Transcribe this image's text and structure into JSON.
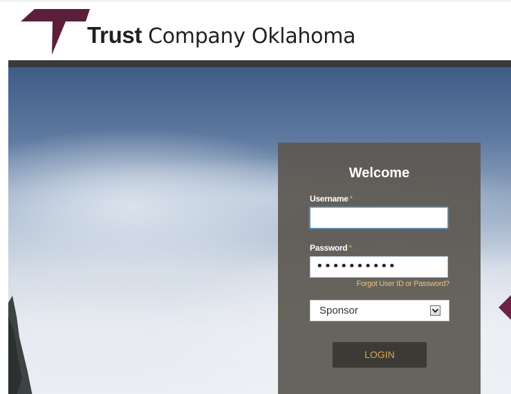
{
  "brand": {
    "name_bold": "Trust",
    "name_regular": "Company Oklahoma",
    "logo_color": "#5c1f3a"
  },
  "login": {
    "title": "Welcome",
    "username_label": "Username",
    "password_label": "Password",
    "required_marker": "*",
    "username_value": "",
    "password_value": "••••••••••",
    "forgot_link": "Forgot User ID or Password?",
    "user_type_selected": "Sponsor",
    "login_button": "LOGIN"
  },
  "carousel": {
    "next_icon": "chevron-left-icon",
    "accent_color": "#6b2447"
  },
  "colors": {
    "panel_bg": "#5c5852",
    "button_bg": "#3b3a35",
    "button_text": "#d9a651",
    "link_color": "#e8c27a",
    "required_color": "#e0a64a",
    "nav_bar": "#3a3a3a"
  }
}
